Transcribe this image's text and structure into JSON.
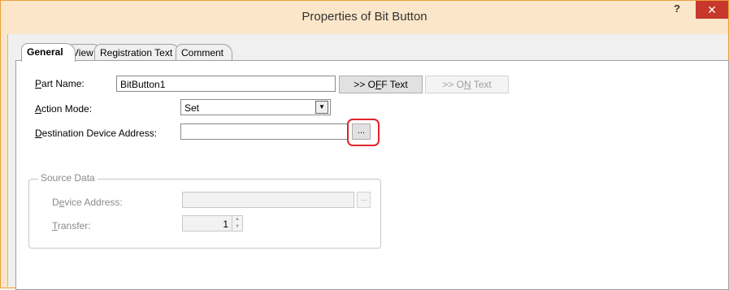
{
  "window": {
    "title": "Properties of Bit Button",
    "help_label": "?",
    "close_label": "✕"
  },
  "tabs": [
    {
      "label": "General",
      "active": true
    },
    {
      "label": "View",
      "active": false
    },
    {
      "label": "Registration Text",
      "active": false
    },
    {
      "label": "Comment",
      "active": false
    }
  ],
  "general": {
    "part_name": {
      "label_prefix": "",
      "label_accel": "P",
      "label_rest": "art Name:",
      "value": "BitButton1"
    },
    "off_text_button": "&gt;&gt; OFF Text",
    "on_text_button": "&gt;&gt; ON Text",
    "action_mode": {
      "label_accel": "A",
      "label_rest": "ction Mode:",
      "value": "Set"
    },
    "destination": {
      "label_accel": "D",
      "label_rest": "estination Device Address:",
      "value": "",
      "browse_label": "..."
    },
    "source_data": {
      "group_label": "Source Data",
      "device_address": {
        "label_prefix": "D",
        "label_accel": "e",
        "label_rest": "vice Address:",
        "value": "",
        "browse_label": "..."
      },
      "transfer": {
        "label_accel": "T",
        "label_rest": "ransfer:",
        "value": "1"
      }
    }
  }
}
